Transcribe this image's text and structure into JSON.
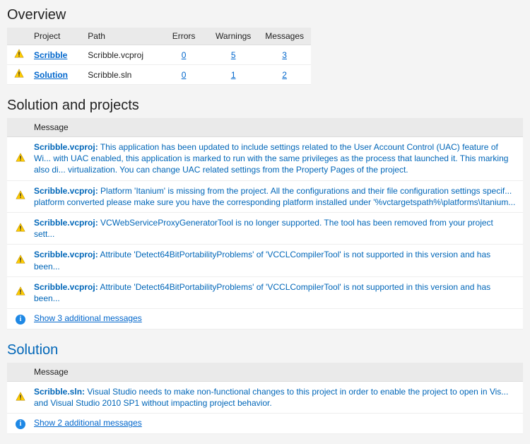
{
  "sections": {
    "overview_title": "Overview",
    "solution_projects_title": "Solution and projects",
    "solution_title": "Solution"
  },
  "overview": {
    "headers": {
      "project": "Project",
      "path": "Path",
      "errors": "Errors",
      "warnings": "Warnings",
      "messages": "Messages"
    },
    "rows": [
      {
        "icon": "warning",
        "project": "Scribble",
        "path": "Scribble.vcproj",
        "errors": "0",
        "warnings": "5",
        "messages": "3"
      },
      {
        "icon": "warning",
        "project": "Solution",
        "path": "Scribble.sln",
        "errors": "0",
        "warnings": "1",
        "messages": "2"
      }
    ]
  },
  "msg_header": "Message",
  "solution_projects": {
    "rows": [
      {
        "icon": "warning",
        "prefix": "Scribble.vcproj:",
        "body": "This application has been updated to include settings related to the User Account Control (UAC) feature of Wi... with UAC enabled, this application is marked to run with the same privileges as the process that launched it. This marking also di... virtualization. You can change UAC related settings from the Property Pages of the project."
      },
      {
        "icon": "warning",
        "prefix": "Scribble.vcproj:",
        "body": "Platform 'Itanium' is missing from the project. All the configurations and their file configuration settings specif... platform converted please make sure you have the corresponding platform installed under '%vctargetspath%\\platforms\\Itanium..."
      },
      {
        "icon": "warning",
        "prefix": "Scribble.vcproj:",
        "body": "VCWebServiceProxyGeneratorTool is no longer supported. The tool has been removed from your project sett..."
      },
      {
        "icon": "warning",
        "prefix": "Scribble.vcproj:",
        "body": "Attribute 'Detect64BitPortabilityProblems' of 'VCCLCompilerTool' is not supported in this version and has been..."
      },
      {
        "icon": "warning",
        "prefix": "Scribble.vcproj:",
        "body": "Attribute 'Detect64BitPortabilityProblems' of 'VCCLCompilerTool' is not supported in this version and has been..."
      }
    ],
    "show_more": "Show 3 additional messages"
  },
  "solution": {
    "rows": [
      {
        "icon": "warning",
        "prefix": "Scribble.sln:",
        "body": "Visual Studio needs to make non-functional changes to this project in order to enable the project to open in Vis... and Visual Studio 2010 SP1 without impacting project behavior."
      }
    ],
    "show_more": "Show 2 additional messages"
  }
}
